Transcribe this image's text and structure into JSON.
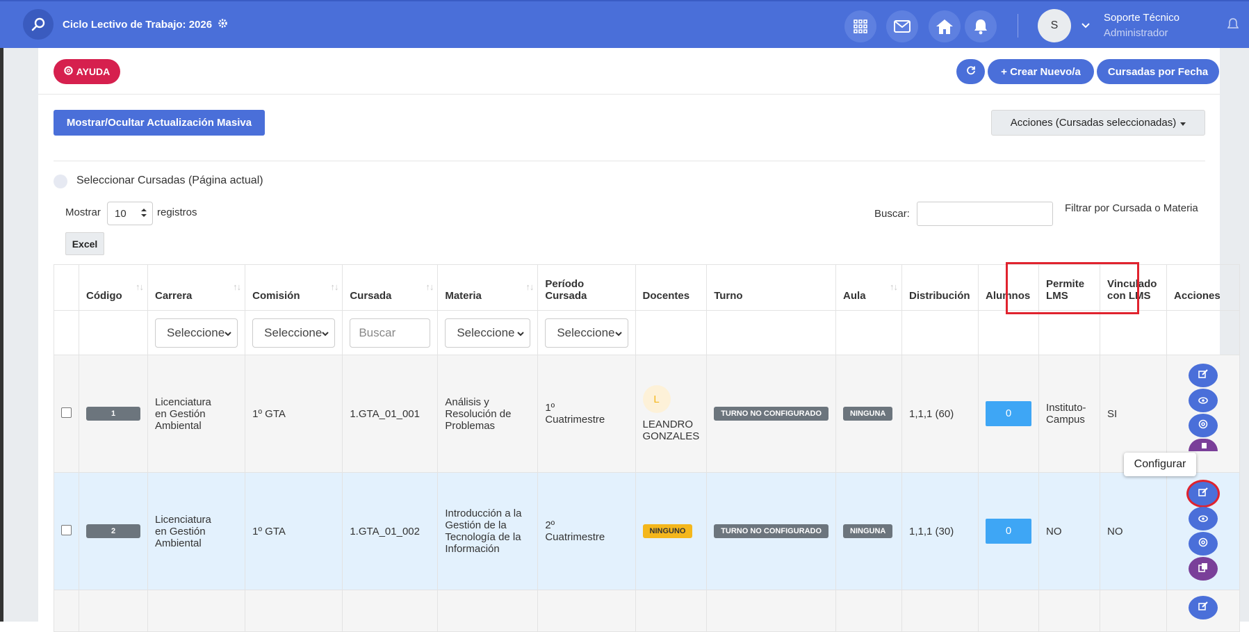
{
  "header": {
    "cycle_title": "Ciclo Lectivo de Trabajo: 2026",
    "icons": [
      "grid-icon",
      "mail-icon",
      "home-icon",
      "bell-icon"
    ],
    "avatar_letter": "S",
    "user_name": "Soporte Técnico",
    "user_role": "Administrador"
  },
  "toolbar": {
    "help_label": "AYUDA",
    "create_label": "+ Crear Nuevo/a",
    "by_date_label": "Cursadas por Fecha",
    "mass_update_label": "Mostrar/Ocultar Actualización Masiva",
    "actions_label": "Acciones (Cursadas seleccionadas)"
  },
  "list_controls": {
    "select_all_label": "Seleccionar Cursadas (Página actual)",
    "show_label": "Mostrar",
    "show_value": "10",
    "records_label": "registros",
    "search_label": "Buscar:",
    "filter_hint": "Filtrar por Cursada o Materia",
    "excel_label": "Excel"
  },
  "table": {
    "headers": {
      "codigo": "Código",
      "carrera": "Carrera",
      "comision": "Comisión",
      "cursada": "Cursada",
      "materia": "Materia",
      "periodo_1": "Período",
      "periodo_2": "Cursada",
      "docentes": "Docentes",
      "turno": "Turno",
      "aula": "Aula",
      "distribucion": "Distribución",
      "alumnos": "Alumnos",
      "permite_1": "Permite",
      "permite_2": "LMS",
      "vinculado_1": "Vinculado",
      "vinculado_2": "con LMS",
      "acciones": "Acciones"
    },
    "filters": {
      "carrera": "Seleccione",
      "comision": "Seleccione",
      "cursada_placeholder": "Buscar",
      "materia": "Seleccione",
      "periodo": "Seleccione"
    },
    "rows": [
      {
        "codigo": "1",
        "carrera": [
          "Licenciatura",
          "en Gestión",
          "Ambiental"
        ],
        "comision": "1º GTA",
        "cursada": "1.GTA_01_001",
        "materia": [
          "Análisis y",
          "Resolución de",
          "Problemas"
        ],
        "periodo": [
          "1º",
          "Cuatrimestre"
        ],
        "docente_initial": "L",
        "docente_name": [
          "LEANDRO",
          "GONZALES"
        ],
        "turno": "TURNO NO CONFIGURADO",
        "aula": "NINGUNA",
        "distribucion": "1,1,1 (60)",
        "alumnos": "0",
        "permite_lms": [
          "Instituto-",
          "Campus"
        ],
        "vinculado_lms": "SI"
      },
      {
        "codigo": "2",
        "carrera": [
          "Licenciatura",
          "en Gestión",
          "Ambiental"
        ],
        "comision": "1º GTA",
        "cursada": "1.GTA_01_002",
        "materia": [
          "Introducción a la",
          "Gestión de la",
          "Tecnología de la",
          "Información"
        ],
        "periodo": [
          "2º",
          "Cuatrimestre"
        ],
        "docente_badge": "NINGUNO",
        "turno": "TURNO NO CONFIGURADO",
        "aula": "NINGUNA",
        "distribucion": "1,1,1 (30)",
        "alumnos": "0",
        "permite_lms": [
          "NO"
        ],
        "vinculado_lms": "NO"
      }
    ]
  },
  "tooltip": "Configurar",
  "colors": {
    "primary": "#4a6fd9",
    "help": "#d6204e",
    "info": "#3ea6f5",
    "highlight": "#e0232e",
    "purple": "#7a3f99"
  }
}
